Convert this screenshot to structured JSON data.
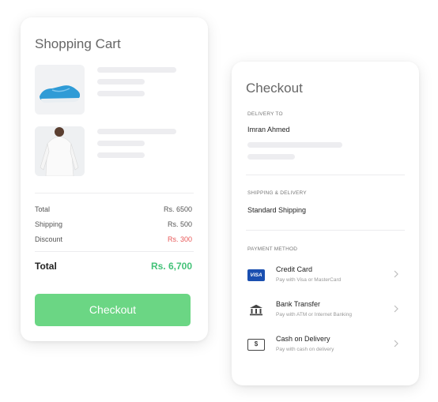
{
  "cart": {
    "title": "Shopping Cart",
    "items": [
      {
        "image_icon": "sneaker-image"
      },
      {
        "image_icon": "tshirt-image"
      }
    ],
    "summary": [
      {
        "label": "Total",
        "value": "Rs. 6500"
      },
      {
        "label": "Shipping",
        "value": "Rs. 500"
      },
      {
        "label": "Discount",
        "value": "Rs. 300"
      }
    ],
    "grand_total_label": "Total",
    "grand_total_value": "Rs. 6,700",
    "checkout_button": "Checkout"
  },
  "checkout": {
    "title": "Checkout",
    "delivery_label": "DELIVERY TO",
    "delivery_name": "Imran Ahmed",
    "shipping_label": "SHIPPING & DELIVERY",
    "shipping_value": "Standard Shipping",
    "payment_label": "PAYMENT METHOD",
    "methods": [
      {
        "name": "Credit Card",
        "sub": "Pay with Visa or MasterCard",
        "icon": "visa-card-icon",
        "badge": "VISA"
      },
      {
        "name": "Bank Transfer",
        "sub": "Pay with ATM or Internet Banking",
        "icon": "bank-icon"
      },
      {
        "name": "Cash on Delivery",
        "sub": "Pay with cash on delivery",
        "icon": "cash-icon",
        "badge": "$"
      }
    ]
  },
  "colors": {
    "accent_green": "#6bd684",
    "total_green": "#43c278",
    "discount_red": "#e85858"
  }
}
